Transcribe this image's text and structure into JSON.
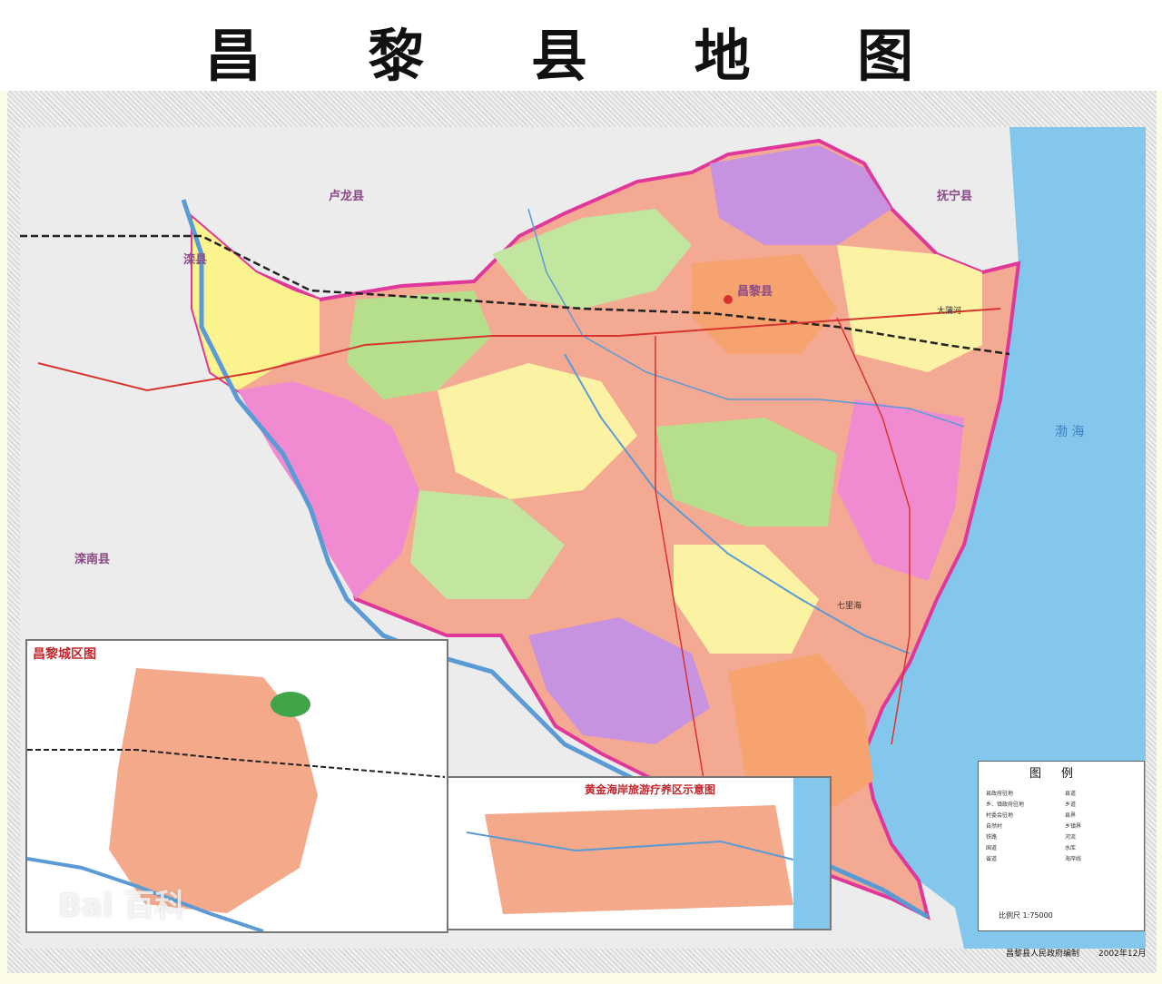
{
  "title": "昌 黎 县 地 图",
  "places": {
    "changli": "昌黎县",
    "luanxian": "滦县",
    "luannan": "滦南县",
    "lulong": "卢龙县",
    "funing": "抚宁县",
    "dapuhe": "大蒲河",
    "bohai": "渤海",
    "qilihai": "七里海"
  },
  "sea": {
    "label": "渤 海"
  },
  "inset_city": {
    "title": "昌黎城区图"
  },
  "inset_coast": {
    "title": "黄金海岸旅游疗养区示意图"
  },
  "legend": {
    "title": "图例",
    "items": [
      "县政府驻地",
      "乡、镇政府驻地",
      "村委会驻地",
      "自然村",
      "铁路",
      "国道",
      "省道",
      "县道",
      "乡道",
      "县界",
      "乡镇界",
      "河流",
      "水库",
      "海岸线"
    ],
    "scale_label": "比例尺 1:75000"
  },
  "footer": {
    "publisher": "昌黎县人民政府编制",
    "date": "2002年12月"
  },
  "watermark": "Bai 百科",
  "colors": {
    "sea": "#7fc4ea",
    "border": "#e0379b",
    "river": "#5b9bd5",
    "road": "#d8342f",
    "railway": "#222222"
  }
}
